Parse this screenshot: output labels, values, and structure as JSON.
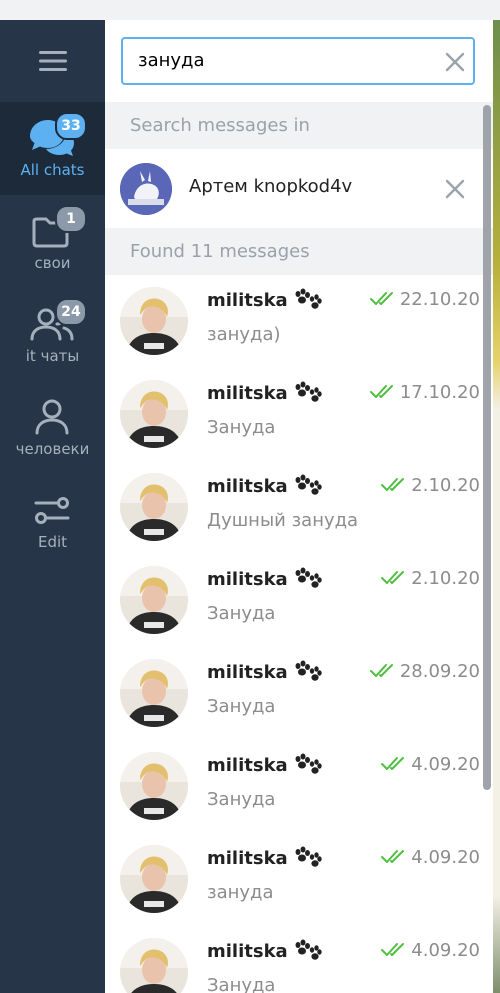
{
  "sidebar": {
    "folders": [
      {
        "label": "All chats",
        "badge": "33",
        "icon": "chats-icon"
      },
      {
        "label": "свои",
        "badge": "1",
        "icon": "folder-icon"
      },
      {
        "label": "it чаты",
        "badge": "24",
        "icon": "users-icon"
      },
      {
        "label": "человеки",
        "badge": "",
        "icon": "user-icon"
      },
      {
        "label": "Edit",
        "badge": "",
        "icon": "sliders-icon"
      }
    ]
  },
  "search": {
    "value": "зануда"
  },
  "peer_filter": {
    "header": "Search messages in",
    "name": "Артем knopkod4v"
  },
  "results": {
    "header": "Found 11 messages",
    "messages": [
      {
        "name": "militska",
        "date": "22.10.20",
        "text": "зануда)"
      },
      {
        "name": "militska",
        "date": "17.10.20",
        "text": "Зануда"
      },
      {
        "name": "militska",
        "date": "2.10.20",
        "text": "Душный зануда"
      },
      {
        "name": "militska",
        "date": "2.10.20",
        "text": "Зануда"
      },
      {
        "name": "militska",
        "date": "28.09.20",
        "text": "Зануда"
      },
      {
        "name": "militska",
        "date": "4.09.20",
        "text": "Зануда"
      },
      {
        "name": "militska",
        "date": "4.09.20",
        "text": "зануда"
      },
      {
        "name": "militska",
        "date": "4.09.20",
        "text": "Зануда"
      }
    ]
  },
  "colors": {
    "sidebar_bg": "#263547",
    "accent": "#5db1f1",
    "check_green": "#4fbf40"
  }
}
